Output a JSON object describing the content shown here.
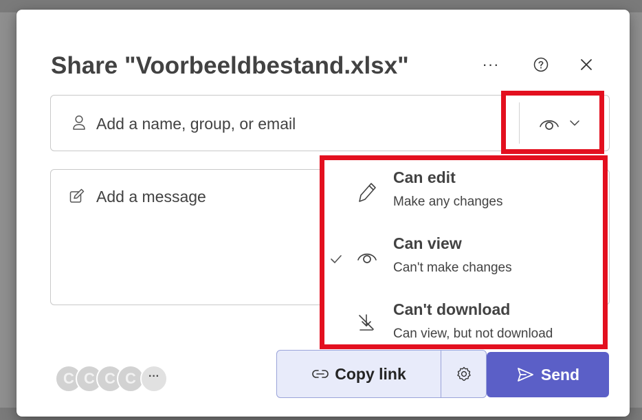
{
  "dialog": {
    "title": "Share \"Voorbeeldbestand.xlsx\"",
    "more_label": "···"
  },
  "recipients": {
    "placeholder": "Add a name, group, or email"
  },
  "permission": {
    "current": "Can view",
    "options": [
      {
        "title": "Can edit",
        "description": "Make any changes",
        "icon": "pencil-icon",
        "selected": false
      },
      {
        "title": "Can view",
        "description": "Can't make changes",
        "icon": "eye-icon",
        "selected": true
      },
      {
        "title": "Can't download",
        "description": "Can view, but not download",
        "icon": "no-download-icon",
        "selected": false
      }
    ]
  },
  "message": {
    "placeholder": "Add a message"
  },
  "footer": {
    "avatar_initials": [
      "C",
      "C",
      "C",
      "C"
    ],
    "avatar_more": "···",
    "copy_link_label": "Copy link",
    "send_label": "Send"
  },
  "colors": {
    "accent": "#5b5fc7",
    "copy_link_bg": "#e8ebfa",
    "highlight": "#e3101f"
  }
}
